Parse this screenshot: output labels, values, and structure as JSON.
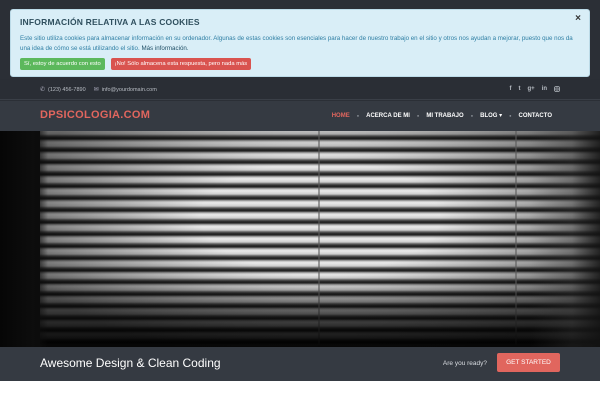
{
  "cookie": {
    "title": "INFORMACIÓN RELATIVA A LAS COOKIES",
    "close": "×",
    "text": "Este sitio utiliza cookies para almacenar información en su ordenador. Algunas de estas cookies son esenciales para hacer de nuestro trabajo en el sitio y otros nos ayudan a mejorar, puesto que nos da una idea de cómo se está utilizando el sitio.",
    "more_link": "Más información.",
    "accept_label": "Sí, estoy de acuerdo con esto",
    "reject_label": "¡No! Sólo almacena esta respuesta, pero nada más"
  },
  "topbar": {
    "phone": "(123) 456-7890",
    "email": "info@yourdomain.com",
    "social": [
      "f",
      "t",
      "g+",
      "in",
      "ig"
    ]
  },
  "header": {
    "brand": "DPSICOLOGIA.COM",
    "nav": [
      {
        "label": "HOME",
        "active": true
      },
      {
        "label": "ACERCA DE MI"
      },
      {
        "label": "MI TRABAJO"
      },
      {
        "label": "BLOG ▾"
      },
      {
        "label": "CONTACTO"
      }
    ]
  },
  "cta": {
    "title": "Awesome Design & Clean Coding",
    "question": "Are you ready?",
    "button": "GET STARTED"
  },
  "colors": {
    "accent": "#e1665e",
    "header_bg": "#353a42",
    "topbar_bg": "#2a2e35",
    "cookie_bg": "#d9eef7"
  }
}
